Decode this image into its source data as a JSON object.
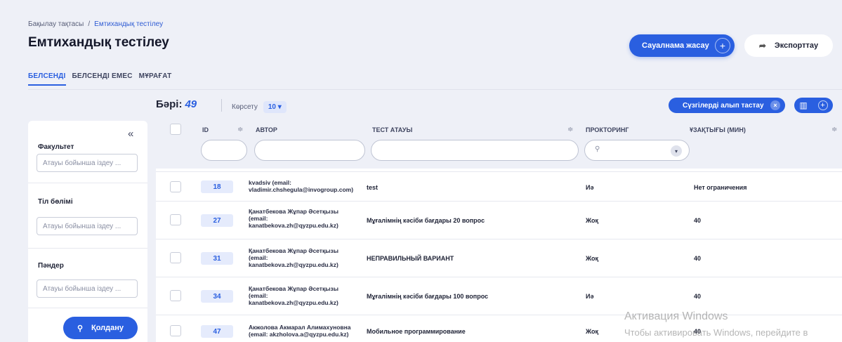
{
  "breadcrumb": {
    "home": "Бақылау тақтасы",
    "separator": "/",
    "current": "Емтихандық тестілеу"
  },
  "page_title": "Емтихандық тестілеу",
  "actions": {
    "create_label": "Сауалнама жасау",
    "create_plus": "+",
    "export_label": "Экспорттау",
    "export_icon": "➦"
  },
  "tabs": [
    "БЕЛСЕНДІ",
    "БЕЛСЕНДІ ЕМЕС",
    "МҰРАҒАТ"
  ],
  "summary": {
    "total_label": "Бәрі:",
    "total_value": "49",
    "show_label": "Көрсету",
    "show_value": "10 ▾"
  },
  "toolbar": {
    "clear_filters_label": "Сүзгілерді алып тастау",
    "clear_x": "×",
    "columns_icon": "▥",
    "columns_plus": "+"
  },
  "sidebar": {
    "collapse_icon": "«",
    "filters": [
      {
        "label": "Факультет",
        "placeholder": "Атауы бойынша іздеу ..."
      },
      {
        "label": "Тіл бөлімі",
        "placeholder": "Атауы бойынша іздеу ..."
      },
      {
        "label": "Пәндер",
        "placeholder": "Атауы бойынша іздеу ..."
      }
    ],
    "apply_label": "Қолдану",
    "apply_icon": "⚲"
  },
  "table": {
    "columns": {
      "id": "ID",
      "author": "АВТОР",
      "title": "ТЕСТ АТАУЫ",
      "proctoring": "ПРОКТОРИНГ",
      "duration": "ҰЗАҚТЫҒЫ (МИН)"
    },
    "sort_icon": "≑",
    "search_icon": "⚲",
    "dropdown_icon": "▾",
    "rows": [
      {
        "id": "18",
        "author": "kvadsiv (email: vladimir.chshegula@invogroup.com)",
        "title": "test",
        "proctoring": "Иә",
        "duration": "Нет ограничения"
      },
      {
        "id": "27",
        "author": "Қанатбекова Жұпар Әсетқызы (email: kanatbekova.zh@qyzpu.edu.kz)",
        "title": "Мұғалімнің кәсіби бағдары 20 вопрос",
        "proctoring": "Жоқ",
        "duration": "40"
      },
      {
        "id": "31",
        "author": "Қанатбекова Жұпар Әсетқызы (email: kanatbekova.zh@qyzpu.edu.kz)",
        "title": "НЕПРАВИЛЬНЫЙ ВАРИАНТ",
        "proctoring": "Жоқ",
        "duration": "40"
      },
      {
        "id": "34",
        "author": "Қанатбекова Жұпар Әсетқызы (email: kanatbekova.zh@qyzpu.edu.kz)",
        "title": "Мұғалімнің кәсіби бағдары 100 вопрос",
        "proctoring": "Иә",
        "duration": "40"
      },
      {
        "id": "47",
        "author": "Акжолова Акмарал Алимахуновна (email: akzholova.a@qyzpu.edu.kz)",
        "title": "Мобильное программирование",
        "proctoring": "Жоқ",
        "duration": "40"
      }
    ]
  },
  "watermark": {
    "line1": "Активация Windows",
    "line2": "Чтобы активировать Windows, перейдите в"
  }
}
